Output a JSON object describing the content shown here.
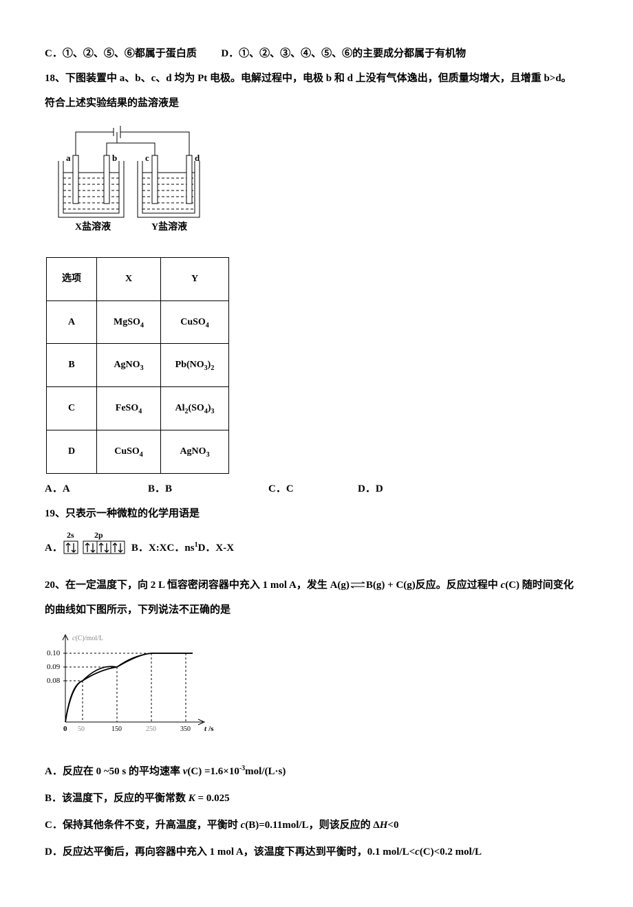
{
  "q17": {
    "C": "C．①、②、⑤、⑥都属于蛋白质",
    "D": "D．①、②、③、④、⑤、⑥的主要成分都属于有机物"
  },
  "q18": {
    "stem1": "18、下图装置中 a、b、c、d 均为 Pt 电极。电解过程中，电极 b 和 d 上没有气体逸出，但质量均增大，且增重 b>d。",
    "stem2": "符合上述实验结果的盐溶液是",
    "labelX": "X盐溶液",
    "labelY": "Y盐溶液",
    "elec_a": "a",
    "elec_b": "b",
    "elec_c": "c",
    "elec_d": "d",
    "table": {
      "hdr_opt": "选项",
      "hdr_x": "X",
      "hdr_y": "Y",
      "A": {
        "opt": "A",
        "x": "MgSO₄",
        "y": "CuSO₄"
      },
      "B": {
        "opt": "B",
        "x": "AgNO₃",
        "y": "Pb(NO₃)₂"
      },
      "C": {
        "opt": "C",
        "x": "FeSO₄",
        "y": "Al₂(SO₄)₃"
      },
      "D": {
        "opt": "D",
        "x": "CuSO₄",
        "y": "AgNO₃"
      }
    },
    "options": {
      "A": "A．A",
      "B": "B．B",
      "C": "C．C",
      "D": "D．D"
    }
  },
  "q19": {
    "stem": "19、只表示一种微粒的化学用语是",
    "orb_2s": "2s",
    "orb_2p": "2p",
    "A_label": "A．",
    "B": "B．X:X",
    "C": "C．ns¹",
    "D": "D．X-X"
  },
  "q20": {
    "stem1": "20、在一定温度下，向 2 L 恒容密闭容器中充入 1 mol A，发生 A(g)⇌B(g) + C(g)反应。反应过程中 c(C) 随时间变化",
    "stem2": "的曲线如下图所示，下列说法不正确的是",
    "ylab": "c(C)/mol/L",
    "y010": "0.10",
    "y009": "0.09",
    "y008": "0.08",
    "x0": "0",
    "x50": "50",
    "x150": "150",
    "x250": "250",
    "x350": "350",
    "xunit_t": "t",
    "xunit_slash": "/s",
    "A": "A．反应在 0 ~50 s 的平均速率 v(C) =1.6×10⁻³mol/(L·s)",
    "B": "B．该温度下，反应的平衡常数 K = 0.025",
    "C": "C．保持其他条件不变，升高温度，平衡时 c(B)=0.11mol/L，则该反应的 ΔH<0",
    "D": "D．反应达平衡后，再向容器中充入 1 mol A，该温度下再达到平衡时，0.1 mol/L<c(C)<0.2 mol/L",
    "italic_v": "v",
    "italic_K": "K",
    "italic_c": "c",
    "italic_H": "H"
  },
  "chart_data": {
    "type": "line",
    "title": "",
    "xlabel": "t /s",
    "ylabel": "c(C)/mol/L",
    "xlim": [
      0,
      380
    ],
    "ylim": [
      0,
      0.11
    ],
    "x": [
      0,
      50,
      150,
      250,
      350
    ],
    "y": [
      0,
      0.08,
      0.09,
      0.1,
      0.1
    ],
    "gridlines_y": [
      0.08,
      0.09,
      0.1
    ],
    "gridlines_x": [
      50,
      150,
      250,
      350
    ]
  }
}
